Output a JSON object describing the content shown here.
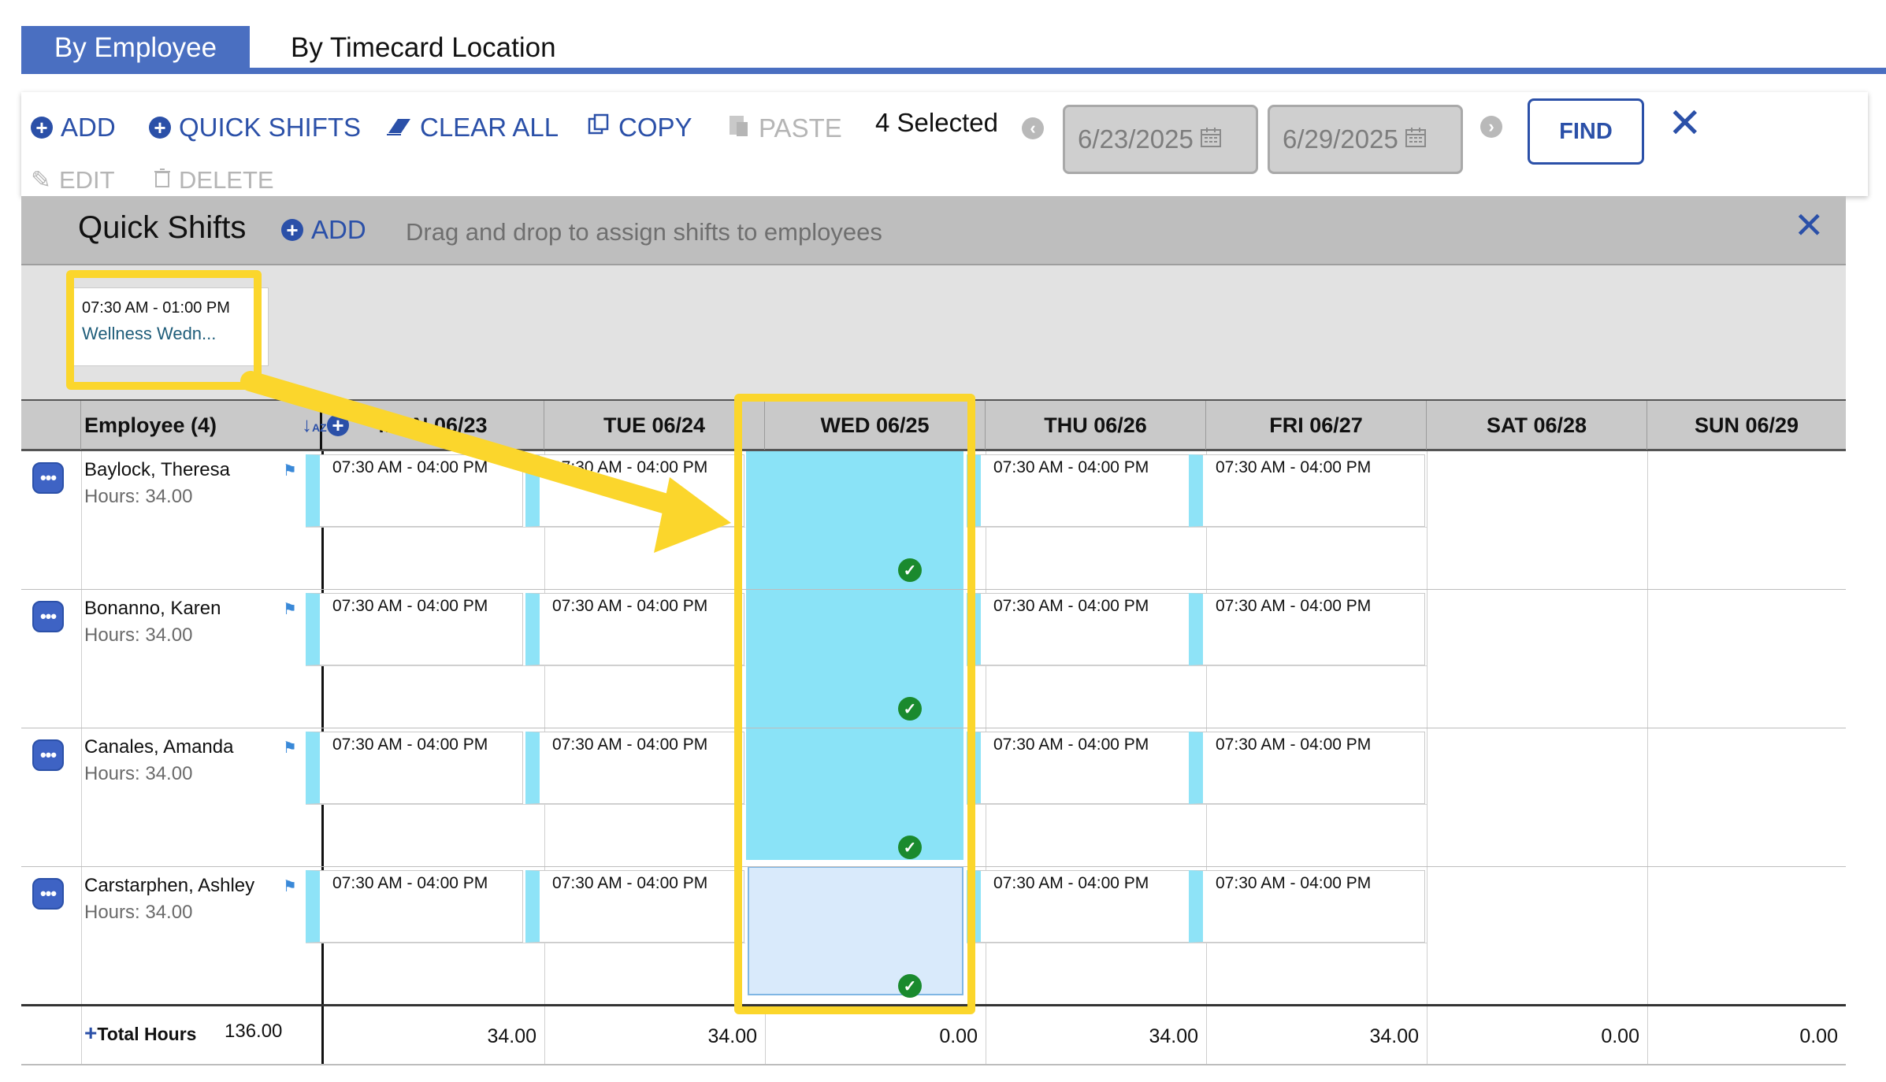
{
  "tabs": [
    {
      "label": "By Employee"
    },
    {
      "label": "By Timecard Location"
    }
  ],
  "toolbar": {
    "add": "ADD",
    "quick_shifts": "QUICK SHIFTS",
    "clear_all": "CLEAR ALL",
    "copy": "COPY",
    "paste": "PASTE",
    "selected": "4 Selected",
    "edit": "EDIT",
    "delete": "DELETE",
    "start_date": "6/23/2025",
    "end_date": "6/29/2025",
    "find": "FIND"
  },
  "quick_shifts": {
    "title": "Quick Shifts",
    "add": "ADD",
    "hint": "Drag and drop to assign shifts to employees",
    "card": {
      "time": "07:30 AM - 01:00 PM",
      "name": "Wellness Wedn..."
    }
  },
  "grid": {
    "employee_header": "Employee (4)",
    "days": [
      "MON 06/23",
      "TUE 06/24",
      "WED 06/25",
      "THU 06/26",
      "FRI 06/27",
      "SAT 06/28",
      "SUN 06/29"
    ],
    "employees": [
      {
        "name": "Baylock, Theresa",
        "hours": "Hours: 34.00"
      },
      {
        "name": "Bonanno, Karen",
        "hours": "Hours: 34.00"
      },
      {
        "name": "Canales, Amanda",
        "hours": "Hours: 34.00"
      },
      {
        "name": "Carstarphen, Ashley",
        "hours": "Hours: 34.00"
      }
    ],
    "shift_text": "07:30 AM - 04:00 PM",
    "total_label": "Total Hours",
    "total_sum": "136.00",
    "day_totals": [
      "34.00",
      "34.00",
      "0.00",
      "34.00",
      "34.00",
      "0.00",
      "0.00"
    ]
  },
  "colors": {
    "accent": "#2b50a8",
    "tab_active": "#4a6fc1",
    "shift_bar": "#8ee3f7",
    "highlight": "#fbd62c",
    "check": "#1a8a2e"
  },
  "icons": [
    "plus-circle-icon",
    "eraser-icon",
    "copy-icon",
    "paste-icon",
    "edit-icon",
    "trash-icon",
    "calendar-icon",
    "arrow-left-icon",
    "arrow-right-icon",
    "close-icon",
    "sort-az-icon",
    "flag-icon",
    "menu-dots-icon",
    "check-circle-icon"
  ]
}
